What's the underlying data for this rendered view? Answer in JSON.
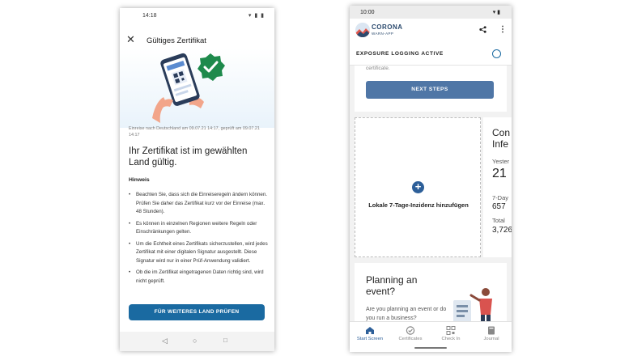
{
  "left_screen": {
    "status_time": "14:18",
    "title": "Gültiges Zertifikat",
    "close_icon": "close-icon",
    "meta": "Einreise nach Deutschland am 09.07.21 14:17, geprüft am 09.07.21 14:17",
    "heading": "Ihr Zertifikat ist im gewählten Land gültig.",
    "hint_title": "Hinweis",
    "hints": [
      "Beachten Sie, dass sich die Einreiseregeln ändern können. Prüfen Sie daher das Zertifikat kurz vor der Einreise (max. 48 Stunden).",
      "Es können in einzelnen Regionen weitere Regeln oder Einschränkungen gelten.",
      "Um die Echtheit eines Zertifikats sicherzustellen, wird jedes Zertifikat mit einer digitalen Signatur ausgestellt. Diese Signatur wird nur in einer Prüf-Anwendung validiert.",
      "Ob die im Zertifikat eingetragenen Daten richtig sind, wird nicht geprüft."
    ],
    "button": "FÜR WEITERES LAND PRÜFEN",
    "accent": "#1a6aa1",
    "badge_color": "#1e8a4c"
  },
  "right_screen": {
    "status_time": "10:00",
    "app_name": "CORONA",
    "app_sub": "WARN-APP",
    "exposure_label": "EXPOSURE LOGGING ACTIVE",
    "certificate_fragment": "certificate.",
    "next_steps": "NEXT STEPS",
    "incidence_card": "Lokale 7-Tage-Inzidenz hinzufügen",
    "stats": {
      "title": "Con Infe",
      "yesterday_label": "Yester",
      "yesterday_value": "21",
      "seven_day_label": "7-Day",
      "seven_day_value": "657",
      "total_label": "Total",
      "total_value": "3,726"
    },
    "plan_title": "Planning an event?",
    "plan_sub": "Are you planning an event or do you run a business?",
    "nav": [
      {
        "label": "Start Screen",
        "icon": "home-icon",
        "active": true
      },
      {
        "label": "Certificates",
        "icon": "certificate-icon",
        "active": false
      },
      {
        "label": "Check In",
        "icon": "qr-code-icon",
        "active": false
      },
      {
        "label": "Journal",
        "icon": "book-icon",
        "active": false
      }
    ],
    "accent": "#2d5f99"
  }
}
